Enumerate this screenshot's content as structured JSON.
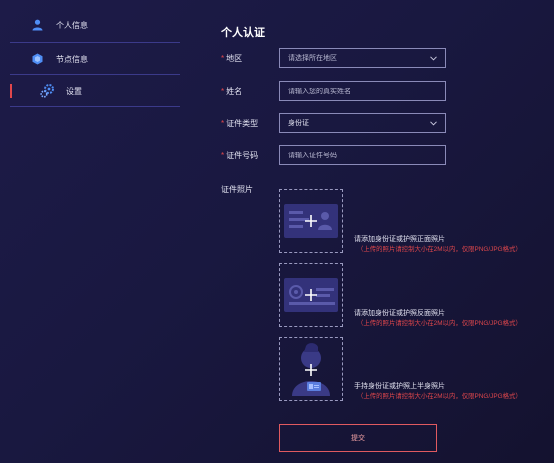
{
  "sidebar": {
    "items": [
      {
        "label": "个人信息",
        "icon": "user-icon"
      },
      {
        "label": "节点信息",
        "icon": "node-icon"
      },
      {
        "label": "设置",
        "icon": "settings-icon"
      }
    ]
  },
  "form": {
    "title": "个人认证",
    "region": {
      "label": "地区",
      "placeholder": "请选择所在地区"
    },
    "name": {
      "label": "姓名",
      "placeholder": "请输入您的真实姓名"
    },
    "id_type": {
      "label": "证件类型",
      "value": "身份证"
    },
    "id_number": {
      "label": "证件号码",
      "placeholder": "请输入证件号码"
    },
    "photo_label": "证件照片",
    "uploads": [
      {
        "text": "请添加身份证或护照正面照片",
        "hint": "（上传的照片请控制大小在2M以内，仅限PNG/JPG格式）"
      },
      {
        "text": "请添加身份证或护照反面照片",
        "hint": "（上传的照片请控制大小在2M以内，仅限PNG/JPG格式）"
      },
      {
        "text": "手持身份证或护照上半身照片",
        "hint": "（上传的照片请控制大小在2M以内，仅限PNG/JPG格式）"
      }
    ],
    "submit_label": "提交",
    "required_mark": "*"
  },
  "colors": {
    "accent": "#e0474c",
    "divider": "#3b3a8a",
    "background": "#1b1a44"
  }
}
